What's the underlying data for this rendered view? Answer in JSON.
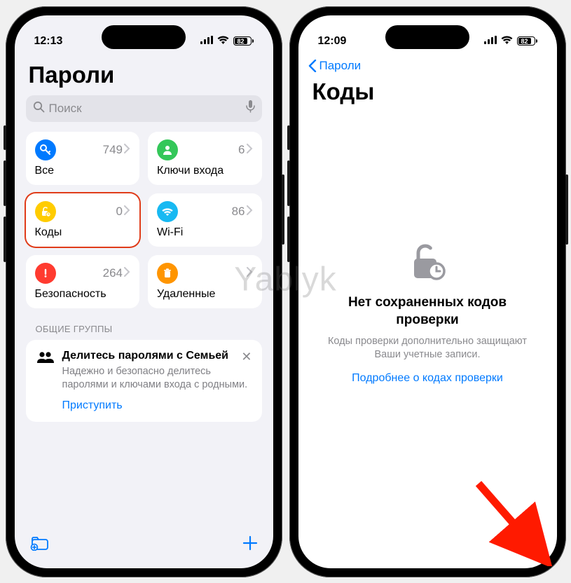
{
  "watermark": "Yablyk",
  "phone1": {
    "status": {
      "time": "12:13",
      "battery": "82"
    },
    "title": "Пароли",
    "search_placeholder": "Поиск",
    "cards": [
      {
        "label": "Все",
        "count": "749",
        "icon": "key",
        "color": "ic-blue"
      },
      {
        "label": "Ключи входа",
        "count": "6",
        "icon": "person",
        "color": "ic-green"
      },
      {
        "label": "Коды",
        "count": "0",
        "icon": "lock",
        "color": "ic-yellow",
        "highlight": true
      },
      {
        "label": "Wi-Fi",
        "count": "86",
        "icon": "wifi",
        "color": "ic-cyan"
      },
      {
        "label": "Безопасность",
        "count": "264",
        "icon": "alert",
        "color": "ic-red"
      },
      {
        "label": "Удаленные",
        "count": "",
        "icon": "trash",
        "color": "ic-orange"
      }
    ],
    "section_header": "ОБЩИЕ ГРУППЫ",
    "promo": {
      "title": "Делитесь паролями с Семьей",
      "text": "Надежно и безопасно делитесь паролями и ключами входа с родными.",
      "action": "Приступить"
    }
  },
  "phone2": {
    "status": {
      "time": "12:09",
      "battery": "82"
    },
    "back_label": "Пароли",
    "title": "Коды",
    "empty": {
      "title": "Нет сохраненных кодов проверки",
      "sub": "Коды проверки дополнительно защищают Ваши учетные записи.",
      "link": "Подробнее о кодах проверки"
    }
  }
}
